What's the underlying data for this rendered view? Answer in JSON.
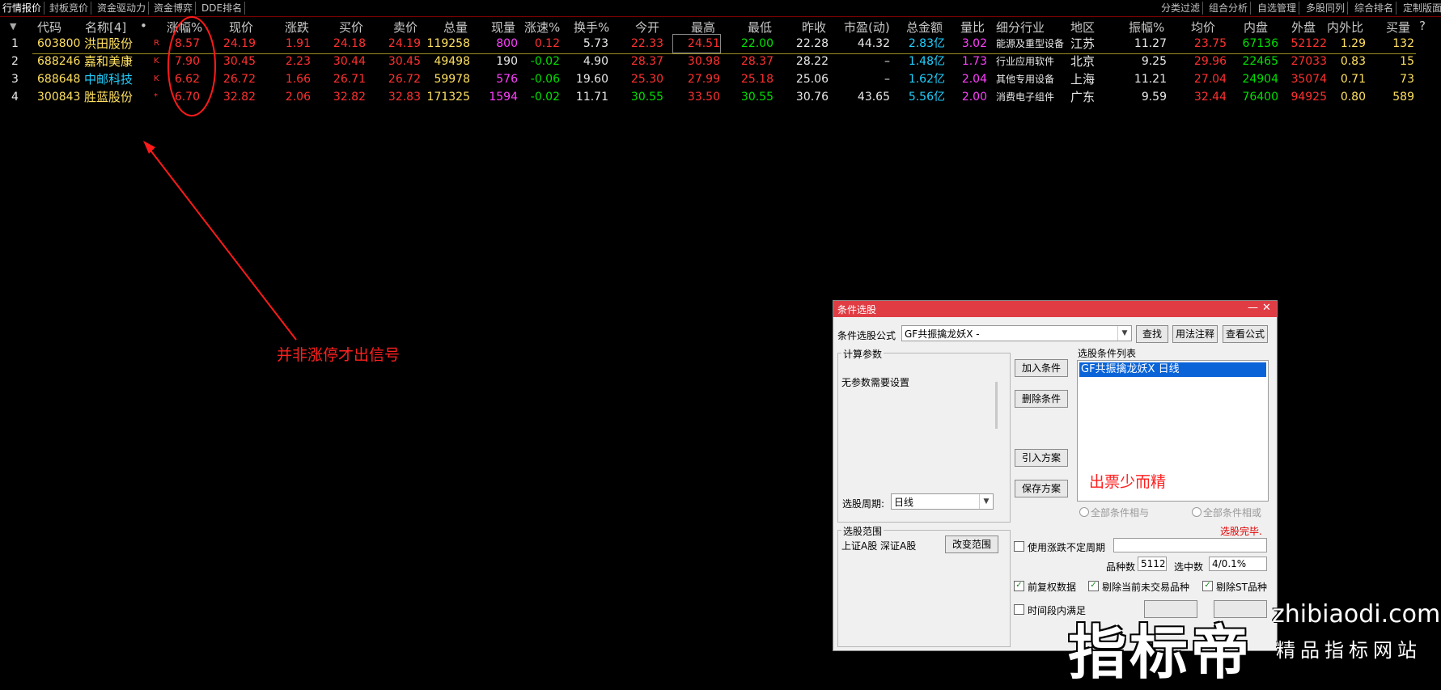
{
  "tabs_left": [
    "行情报价",
    "封板竞价",
    "资金驱动力",
    "资金博弈",
    "DDE排名"
  ],
  "tabs_right": [
    "分类过滤",
    "组合分析",
    "自选管理",
    "多股同列",
    "综合排名",
    "定制版面"
  ],
  "headers": [
    "代码",
    "名称[4]",
    "•",
    "涨幅%",
    "现价",
    "涨跌",
    "买价",
    "卖价",
    "总量",
    "现量",
    "涨速%",
    "换手%",
    "今开",
    "最高",
    "最低",
    "昨收",
    "市盈(动)",
    "总金额",
    "量比",
    "细分行业",
    "地区",
    "振幅%",
    "均价",
    "内盘",
    "外盘",
    "内外比",
    "买量",
    "?"
  ],
  "rows": [
    {
      "idx": "1",
      "code": "603800",
      "name": "洪田股份",
      "flag": "R",
      "chg_pct": "8.57",
      "price": "24.19",
      "chg": "1.91",
      "bid": "24.18",
      "ask": "24.19",
      "vol": "119258",
      "cur_vol": "800",
      "speed": "0.12",
      "turnover": "5.73",
      "open": "22.33",
      "high": "24.51",
      "low": "22.00",
      "prev": "22.28",
      "pe": "44.32",
      "amount": "2.83亿",
      "vol_ratio": "3.02",
      "industry": "能源及重型设备",
      "region": "江苏",
      "amplitude": "11.27",
      "avg": "23.75",
      "inner": "67136",
      "outer": "52122",
      "io_ratio": "1.29",
      "buy_vol": "132"
    },
    {
      "idx": "2",
      "code": "688246",
      "name": "嘉和美康",
      "flag": "K",
      "chg_pct": "7.90",
      "price": "30.45",
      "chg": "2.23",
      "bid": "30.44",
      "ask": "30.45",
      "vol": "49498",
      "cur_vol": "190",
      "speed": "-0.02",
      "turnover": "4.90",
      "open": "28.37",
      "high": "30.98",
      "low": "28.37",
      "prev": "28.22",
      "pe": "–",
      "amount": "1.48亿",
      "vol_ratio": "1.73",
      "industry": "行业应用软件",
      "region": "北京",
      "amplitude": "9.25",
      "avg": "29.96",
      "inner": "22465",
      "outer": "27033",
      "io_ratio": "0.83",
      "buy_vol": "15"
    },
    {
      "idx": "3",
      "code": "688648",
      "name": "中邮科技",
      "flag": "K",
      "chg_pct": "6.62",
      "price": "26.72",
      "chg": "1.66",
      "bid": "26.71",
      "ask": "26.72",
      "vol": "59978",
      "cur_vol": "576",
      "speed": "-0.06",
      "turnover": "19.60",
      "open": "25.30",
      "high": "27.99",
      "low": "25.18",
      "prev": "25.06",
      "pe": "–",
      "amount": "1.62亿",
      "vol_ratio": "2.04",
      "industry": "其他专用设备",
      "region": "上海",
      "amplitude": "11.21",
      "avg": "27.04",
      "inner": "24904",
      "outer": "35074",
      "io_ratio": "0.71",
      "buy_vol": "73"
    },
    {
      "idx": "4",
      "code": "300843",
      "name": "胜蓝股份",
      "flag": "*",
      "chg_pct": "6.70",
      "price": "32.82",
      "chg": "2.06",
      "bid": "32.82",
      "ask": "32.83",
      "vol": "171325",
      "cur_vol": "1594",
      "speed": "-0.02",
      "turnover": "11.71",
      "open": "30.55",
      "high": "33.50",
      "low": "30.55",
      "prev": "30.76",
      "pe": "43.65",
      "amount": "5.56亿",
      "vol_ratio": "2.00",
      "industry": "消费电子组件",
      "region": "广东",
      "amplitude": "9.59",
      "avg": "32.44",
      "inner": "76400",
      "outer": "94925",
      "io_ratio": "0.80",
      "buy_vol": "589"
    }
  ],
  "annotations": {
    "signal_note": "并非涨停才出信号",
    "precise_note": "出票少而精"
  },
  "dialog": {
    "title": "条件选股",
    "formula_label": "条件选股公式",
    "formula_value": "GF共振擒龙妖X  -",
    "btn_find": "查找",
    "btn_usage": "用法注释",
    "btn_view": "查看公式",
    "calc_params_label": "计算参数",
    "no_params": "无参数需要设置",
    "period_label": "选股周期:",
    "period_value": "日线",
    "btn_add": "加入条件",
    "btn_delete": "删除条件",
    "btn_import": "引入方案",
    "btn_save": "保存方案",
    "cond_list_label": "选股条件列表",
    "cond_item": "GF共振擒龙妖X  日线",
    "radio_and": "全部条件相与",
    "radio_or": "全部条件相或",
    "status": "选股完毕.",
    "range_label": "选股范围",
    "range_value": "上证A股 深证A股",
    "btn_range": "改变范围",
    "use_period": "使用涨跌不定周期",
    "count_label": "品种数",
    "count_value": "5112",
    "selected_label": "选中数",
    "selected_value": "4/0.1%",
    "chk_prior": "前复权数据",
    "chk_notrade": "剔除当前未交易品种",
    "chk_st": "剔除ST品种",
    "chk_time": "时间段内满足"
  },
  "watermark": {
    "brand": "指标帝",
    "url": "zhibiaodi.com",
    "slogan": "精品指标网站"
  }
}
